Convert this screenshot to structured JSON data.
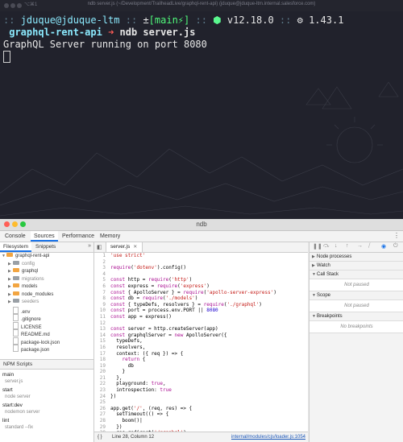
{
  "terminal": {
    "window_title": "ndb server.js (~/Development/TrailheadLive/graphql-rent-api) (jduque@jduque-ltm.internal.salesforce.com)",
    "window_shortcut": "⌥⌘1",
    "prompt_line": {
      "sep_start": "::",
      "user_host": "jduque@jduque-ltm",
      "sep1": "::",
      "git_symbol": "±",
      "branch": "[main⚡]",
      "sep2": "::",
      "node_icon": "⬢",
      "node_version": "v12.18.0",
      "sep3": "::",
      "gear_icon": "⚙",
      "tool_version": "1.43.1"
    },
    "dir_line": {
      "directory": "graphql-rent-api",
      "arrow": "➜",
      "command": "ndb server.js"
    },
    "output": "GraphQL Server running on port 8080"
  },
  "ndb": {
    "window_title": "ndb",
    "tabs": [
      "Console",
      "Sources",
      "Performance",
      "Memory"
    ],
    "active_tab": "Sources",
    "navigator": {
      "tabs": [
        "Filesystem",
        "Snippets"
      ],
      "tree": [
        {
          "label": "graphql-rent-api",
          "type": "folder"
        },
        {
          "label": "config",
          "type": "folder-gray"
        },
        {
          "label": "graphql",
          "type": "folder"
        },
        {
          "label": "migrations",
          "type": "folder-gray"
        },
        {
          "label": "models",
          "type": "folder"
        },
        {
          "label": "node_modules",
          "type": "folder"
        },
        {
          "label": "seeders",
          "type": "folder-gray"
        },
        {
          "label": ".env",
          "type": "file"
        },
        {
          "label": ".gitignore",
          "type": "file"
        },
        {
          "label": "LICENSE",
          "type": "file"
        },
        {
          "label": "README.md",
          "type": "file"
        },
        {
          "label": "package-lock.json",
          "type": "file"
        },
        {
          "label": "package.json",
          "type": "file"
        }
      ],
      "npm_header": "NPM Scripts",
      "npm_scripts": [
        {
          "name": "main",
          "cmd": "server.js"
        },
        {
          "name": "start",
          "cmd": "node server"
        },
        {
          "name": "start:dev",
          "cmd": "nodemon server"
        },
        {
          "name": "lint",
          "cmd": "standard --fix"
        }
      ]
    },
    "editor": {
      "file_tab": "server.js",
      "status_brace": "{ }",
      "status_position": "Line 28, Column 12",
      "status_link": "internal/modules/cjs/loader.js:1054",
      "code_lines": [
        "'use strict'",
        "",
        "require('dotenv').config()",
        "",
        "const http = require('http')",
        "const express = require('express')",
        "const { ApolloServer } = require('apollo-server-express')",
        "const db = require('./models')",
        "const { typeDefs, resolvers } = require('./graphql')",
        "const port = process.env.PORT || 8080",
        "const app = express()",
        "",
        "const server = http.createServer(app)",
        "const graphqlServer = new ApolloServer({",
        "  typeDefs,",
        "  resolvers,",
        "  context: ({ req }) => {",
        "    return {",
        "      db",
        "    }",
        "  },",
        "  playground: true,",
        "  introspection: true",
        "})",
        "",
        "app.get('/', (req, res) => {",
        "  setTimeout(() => {",
        "    boom()|",
        "  })",
        "  res.redirect('/graphql')",
        "})",
        "",
        "function boom() {"
      ]
    },
    "debugger": {
      "panes": [
        {
          "title": "Node processes",
          "expanded": false,
          "body": ""
        },
        {
          "title": "Watch",
          "expanded": false,
          "body": ""
        },
        {
          "title": "Call Stack",
          "expanded": true,
          "body": "Not paused"
        },
        {
          "title": "Scope",
          "expanded": true,
          "body": "Not paused"
        },
        {
          "title": "Breakpoints",
          "expanded": true,
          "body": "No breakpoints"
        }
      ]
    }
  },
  "colors": {
    "terminal_bg": "#21222c",
    "accent": "#1a73e8",
    "folder": "#f2a541"
  }
}
